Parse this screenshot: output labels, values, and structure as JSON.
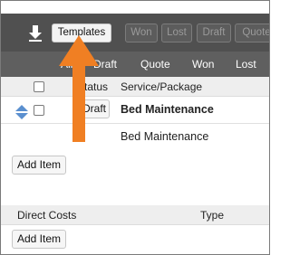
{
  "toolbar": {
    "buttons": [
      "Templates",
      "Won",
      "Lost",
      "Draft",
      "Quote"
    ],
    "download_icon": "download-icon"
  },
  "tabs": [
    "All",
    "Draft",
    "Quote",
    "Won",
    "Lost"
  ],
  "table": {
    "headers": [
      "Status",
      "Service/Package"
    ],
    "rows": [
      {
        "status": "Draft",
        "service": "Bed Maintenance"
      },
      {
        "service": "Bed Maintenance"
      }
    ],
    "add_label": "Add Item"
  },
  "direct_costs": {
    "headers": [
      "Direct Costs",
      "Type"
    ],
    "add_label": "Add Item"
  },
  "annotation": {
    "arrow_color": "#f07f23",
    "icon": "up-arrow-icon"
  },
  "colors": {
    "toolbar_bg": "#505050",
    "tabs_bg": "#5f5f5f",
    "header_bg": "#eeeeee"
  }
}
